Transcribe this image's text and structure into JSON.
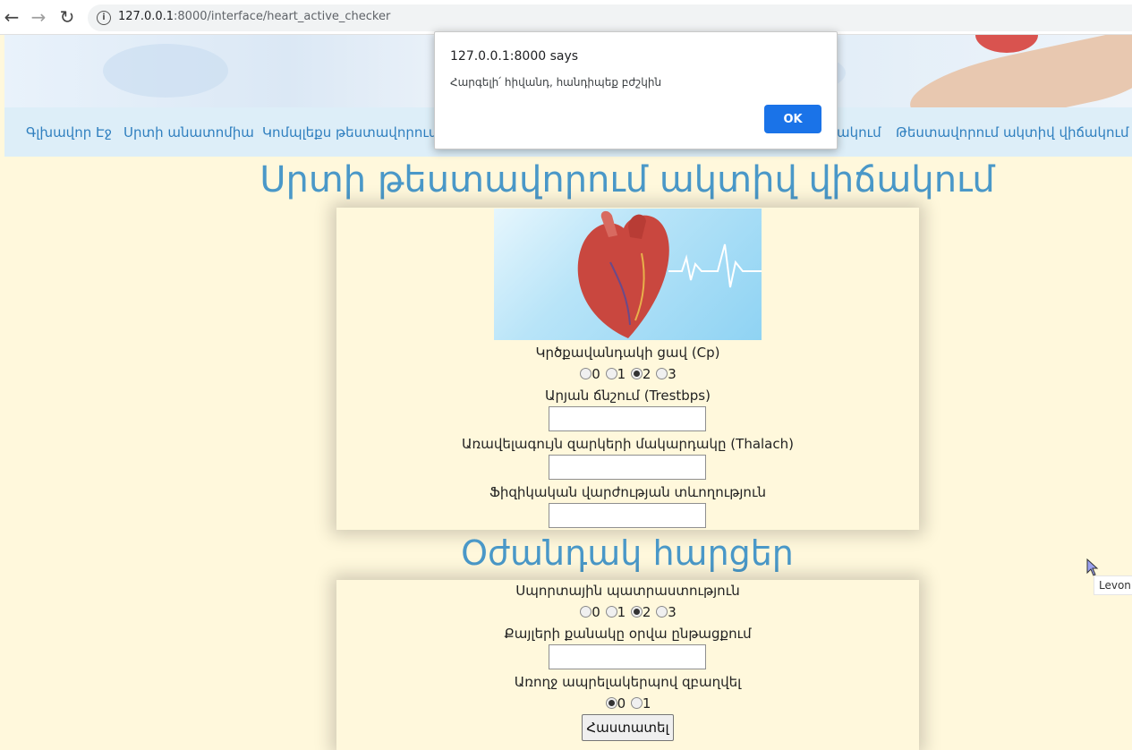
{
  "browser": {
    "url_host": "127.0.0.1",
    "url_rest": ":8000/interface/heart_active_checker",
    "back_icon": "back-arrow-icon",
    "forward_icon": "forward-arrow-icon",
    "reload_icon": "reload-icon"
  },
  "nav": {
    "links": [
      "Գլխավոր Էջ",
      "Սրտի անատոմիա",
      "Կոմպլեքս թեստավորում",
      "ակում",
      "Թեստավորում ակտիվ վիճակում"
    ]
  },
  "main": {
    "title": "Սրտի թեստավորում ակտիվ վիճակում",
    "cp_label": "Կրծքավանդակի ցավ (Cp)",
    "cp_options": [
      "0",
      "1",
      "2",
      "3"
    ],
    "cp_selected": "2",
    "trestbps_label": "Արյան ճնշում (Trestbps)",
    "thalach_label": "Առավելագույն զարկերի մակարդակը (Thalach)",
    "exercise_label": "Ֆիզիկական վարժության տևողություն"
  },
  "extra": {
    "title": "Օժանդակ հարցեր",
    "sport_label": "Սպորտային պատրաստություն",
    "sport_options": [
      "0",
      "1",
      "2",
      "3"
    ],
    "sport_selected": "2",
    "steps_label": "Քայլերի քանակը օրվա ընթացքում",
    "healthy_label": "Առողջ ապրելակերպով զբաղվել",
    "healthy_options": [
      "0",
      "1"
    ],
    "healthy_selected": "0",
    "submit_label": "Հաստատել"
  },
  "dialog": {
    "title": "127.0.0.1:8000 says",
    "message": "Հարգելի՛ հիվանդ, հանդիպեք բժշկին",
    "ok_label": "OK"
  },
  "tooltip": {
    "text": "Levon"
  },
  "colors": {
    "page_bg": "#fff8dc",
    "heading": "#4a98c8",
    "nav_link": "#2f7fbf",
    "nav_bg": "#ddeef8",
    "ok_button": "#1a73e8"
  }
}
